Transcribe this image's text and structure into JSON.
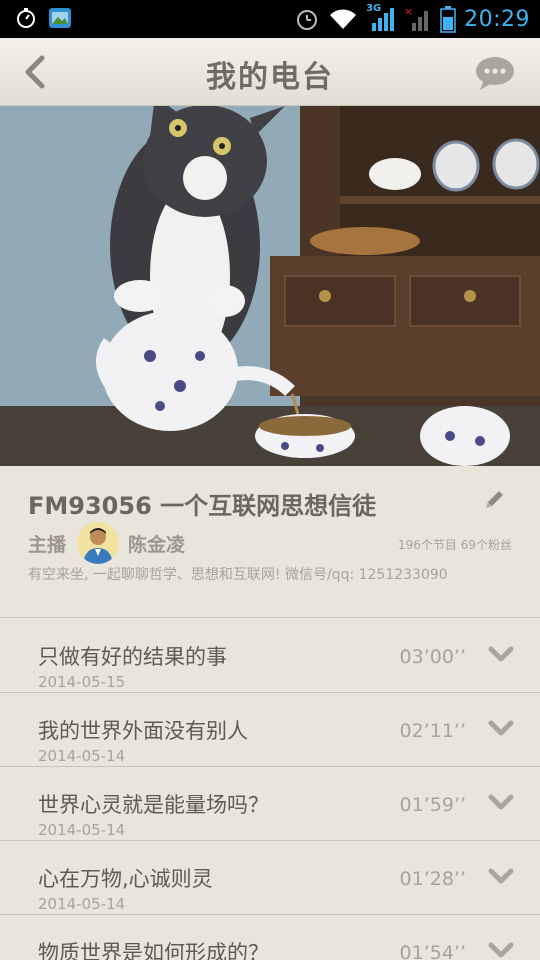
{
  "status_bar": {
    "time": "20:29",
    "network": "3G"
  },
  "header": {
    "title": "我的电台"
  },
  "radio": {
    "title": "FM93056  一个互联网思想信徒",
    "host_label": "主播",
    "host_name": "陈金凌",
    "stats": "196个节目 69个粉丝",
    "description": "有空来坐, 一起聊聊哲学、思想和互联网! 微信号/qq: 1251233090"
  },
  "episodes": [
    {
      "title": "只做有好的结果的事",
      "date": "2014-05-15",
      "duration": "03’00’’"
    },
    {
      "title": "我的世界外面没有别人",
      "date": "2014-05-14",
      "duration": "02’11’’"
    },
    {
      "title": "世界心灵就是能量场吗？",
      "date": "2014-05-14",
      "duration": "01’59’’"
    },
    {
      "title": "心在万物,心诚则灵",
      "date": "2014-05-14",
      "duration": "01’28’’"
    },
    {
      "title": "物质世界是如何形成的？",
      "date": "",
      "duration": "01’54’’"
    }
  ],
  "colors": {
    "accent_time": "#3db4f2",
    "background": "#e8e5dc"
  }
}
